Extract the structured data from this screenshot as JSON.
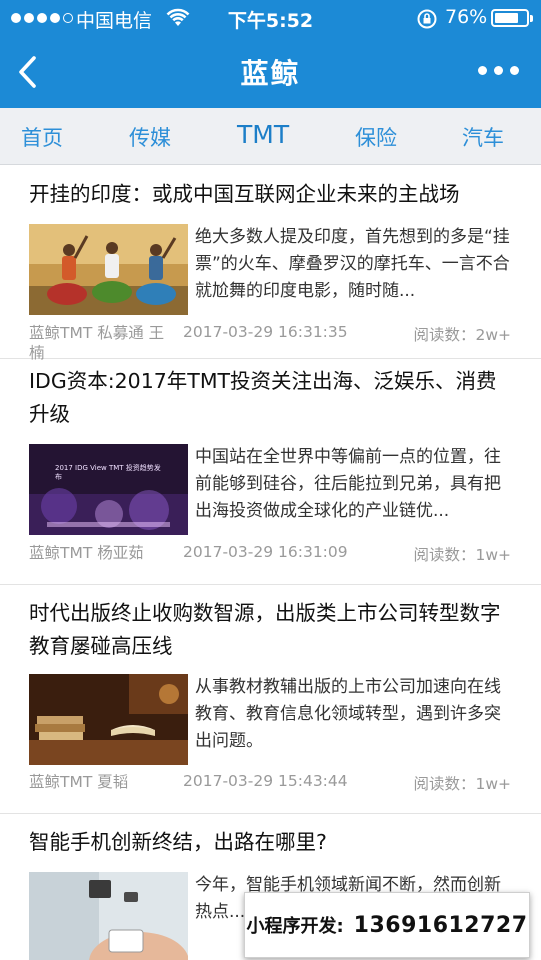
{
  "status": {
    "carrier": "中国电信",
    "time": "下午5:52",
    "battery": "76%",
    "battery_level": 0.76
  },
  "header": {
    "title": "蓝鲸"
  },
  "tabs": [
    {
      "label": "首页"
    },
    {
      "label": "传媒"
    },
    {
      "label": "TMT",
      "active": true
    },
    {
      "label": "保险"
    },
    {
      "label": "汽车"
    }
  ],
  "articles": [
    {
      "title": "开挂的印度：或成中国互联网企业未来的主战场",
      "summary": "绝大多数人提及印度，首先想到的多是“挂票”的火车、摩叠罗汉的摩托车、一言不合就尬舞的印度电影，随时随...",
      "author": "蓝鲸TMT 私募通 王楠",
      "date": "2017-03-29 16:31:35",
      "reads": "阅读数：2w+"
    },
    {
      "title": "IDG资本:2017年TMT投资关注出海、泛娱乐、消费升级",
      "summary": "中国站在全世界中等偏前一点的位置，往前能够到硅谷，往后能拉到兄弟，具有把出海投资做成全球化的产业链优...",
      "author": "蓝鲸TMT 杨亚茹",
      "date": "2017-03-29 16:31:09",
      "reads": "阅读数：1w+",
      "thumb_caption": "2017 IDG View TMT 投资趋势发布"
    },
    {
      "title": "时代出版终止收购数智源，出版类上市公司转型数字教育屡碰高压线",
      "summary": "从事教材教辅出版的上市公司加速向在线教育、教育信息化领域转型，遇到许多突出问题。",
      "author": "蓝鲸TMT 夏韬",
      "date": "2017-03-29 15:43:44",
      "reads": "阅读数：1w+"
    },
    {
      "title": "智能手机创新终结，出路在哪里?",
      "summary": "今年，智能手机领域新闻不断，然而创新热点..."
    }
  ],
  "promo": {
    "label": "小程序开发:",
    "phone": "13691612727"
  }
}
